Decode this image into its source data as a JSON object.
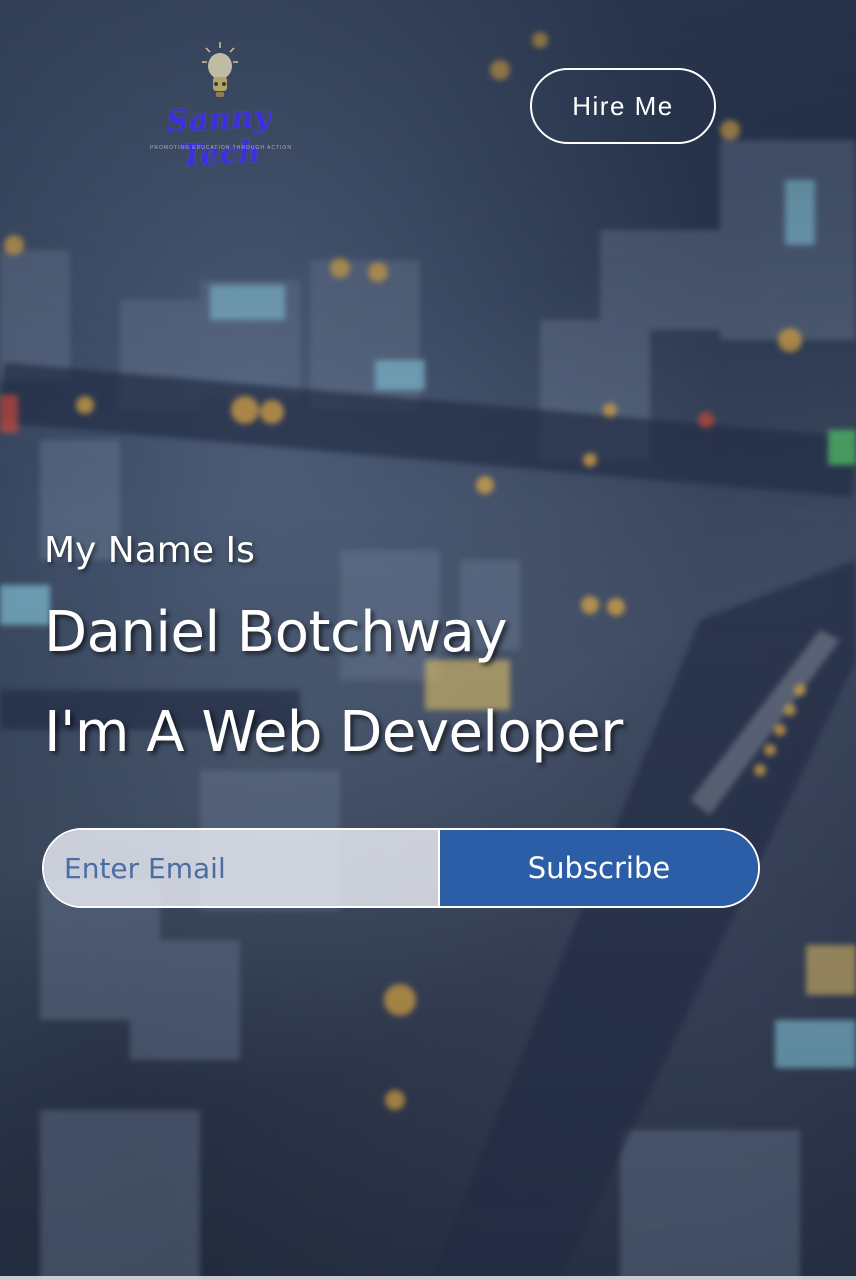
{
  "header": {
    "logo": {
      "brand": "Sanny Tech",
      "tagline": "PROMOTING EDUCATION THROUGH ACTION",
      "icon": "lightbulb-icon"
    },
    "hire_button_label": "Hire Me"
  },
  "hero": {
    "intro": "My Name Is",
    "name": "Daniel Botchway",
    "role": "I'm A Web Developer"
  },
  "subscribe": {
    "email_placeholder": "Enter Email",
    "email_value": "",
    "button_label": "Subscribe"
  },
  "colors": {
    "subscribe_button": "#2b5ea6",
    "brand_text": "#3b2fe0",
    "placeholder_text": "#4a6ea3"
  }
}
